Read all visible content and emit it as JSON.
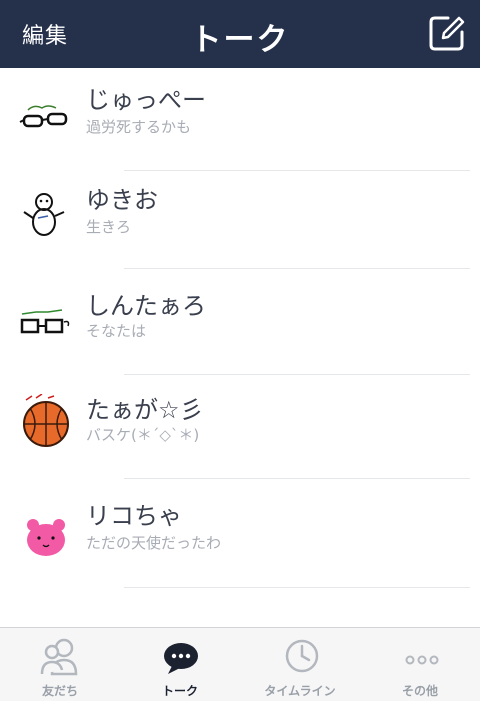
{
  "navbar": {
    "edit_label": "編集",
    "title": "トーク",
    "compose_icon": "compose-icon",
    "bg_color": "#25304a"
  },
  "chats": [
    {
      "name": "じゅっぺー",
      "message": "過労死するかも",
      "avatar": "glasses-doodle"
    },
    {
      "name": "ゆきお",
      "message": "生きろ",
      "avatar": "snowman-doodle"
    },
    {
      "name": "しんたぁろ",
      "message": "そなたは",
      "avatar": "glasses-doodle"
    },
    {
      "name": "たぁが☆彡",
      "message": "バスケ(＊´◇`＊)",
      "avatar": "basketball"
    },
    {
      "name": "リコちゃ",
      "message": "ただの天使だったわ",
      "avatar": "pink-bear"
    }
  ],
  "tabs": [
    {
      "label": "友だち",
      "icon": "friends-icon",
      "active": false
    },
    {
      "label": "トーク",
      "icon": "chat-bubble-icon",
      "active": true
    },
    {
      "label": "タイムライン",
      "icon": "clock-icon",
      "active": false
    },
    {
      "label": "その他",
      "icon": "more-icon",
      "active": false
    }
  ],
  "colors": {
    "active_tab": "#1d2230",
    "inactive_tab": "#9aa0a8"
  }
}
